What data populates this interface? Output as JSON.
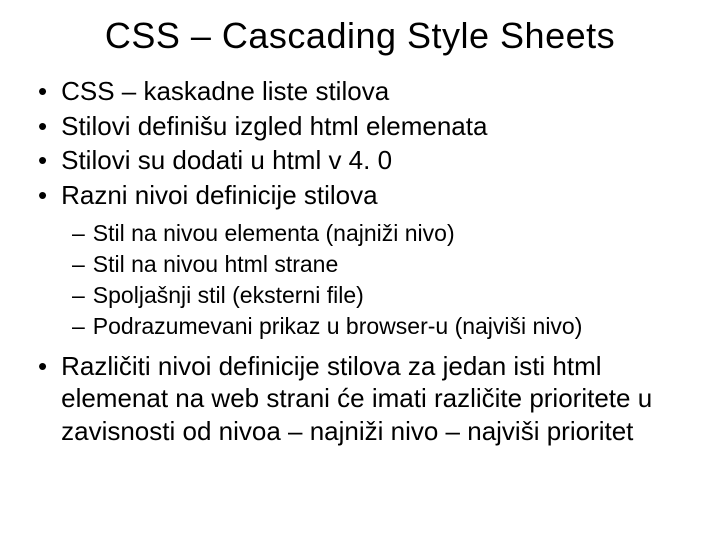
{
  "title": "CSS – Cascading Style Sheets",
  "bullets": [
    {
      "text": "CSS – kaskadne liste stilova"
    },
    {
      "text": "Stilovi definišu izgled html elemenata"
    },
    {
      "text": "Stilovi su dodati u html v 4. 0"
    },
    {
      "text": "Razni nivoi definicije stilova"
    }
  ],
  "sub_bullets": [
    {
      "text": "Stil na nivou elementa (najniži nivo)"
    },
    {
      "text": "Stil na nivou html strane"
    },
    {
      "text": "Spoljašnji stil (eksterni file)"
    },
    {
      "text": "Podrazumevani prikaz u browser-u (najviši nivo)"
    }
  ],
  "final_bullet": {
    "text": "Različiti nivoi definicije stilova za jedan isti html elemenat na web strani će imati različite prioritete u zavisnosti od nivoa – najniži nivo – najviši prioritet"
  },
  "markers": {
    "bullet": "•",
    "dash": "–"
  }
}
